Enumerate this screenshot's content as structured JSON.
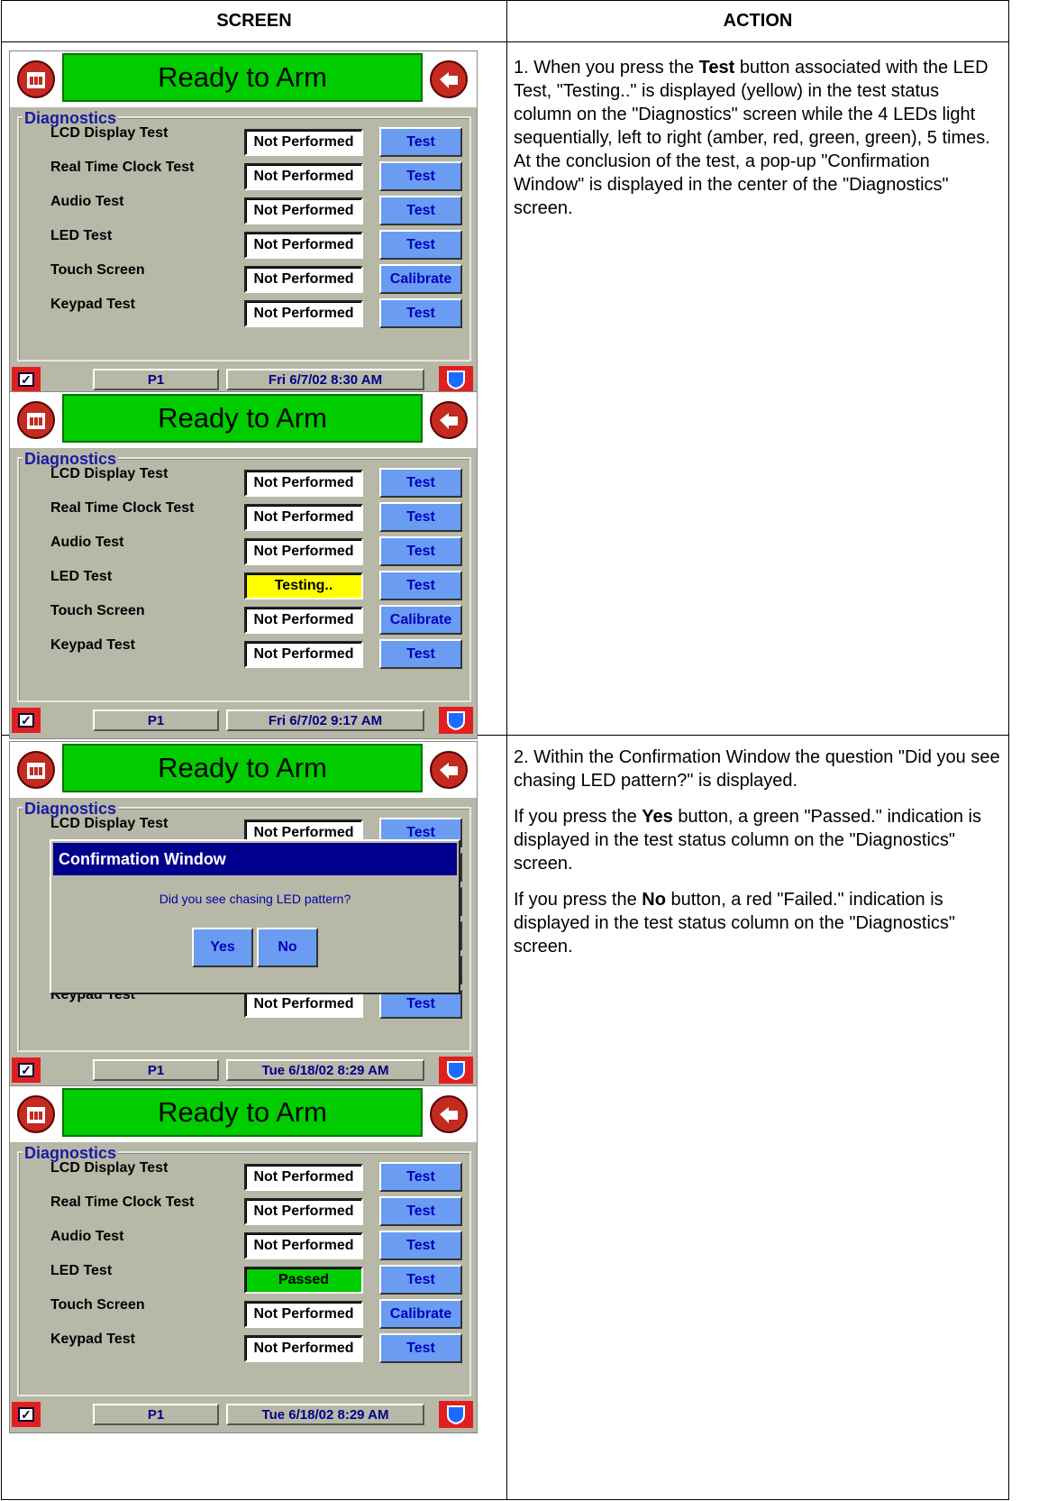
{
  "table": {
    "header_screen": "SCREEN",
    "header_action": "ACTION"
  },
  "device": {
    "banner": "Ready to Arm",
    "group_title": "Diagnostics",
    "page_label": "P1",
    "tests": [
      {
        "label": "LCD Display Test",
        "button": "Test"
      },
      {
        "label": "Real Time Clock Test",
        "button": "Test"
      },
      {
        "label": "Audio Test",
        "button": "Test"
      },
      {
        "label": "LED Test",
        "button": "Test"
      },
      {
        "label": "Touch Screen",
        "button": "Calibrate"
      },
      {
        "label": "Keypad Test",
        "button": "Test"
      }
    ],
    "status_not_performed": "Not Performed",
    "status_testing": "Testing..",
    "status_passed": "Passed",
    "check_glyph": "✓"
  },
  "screens": [
    {
      "datetime": "Fri 6/7/02  8:30 AM"
    },
    {
      "datetime": "Fri 6/7/02  9:17 AM"
    },
    {
      "datetime": "Tue 6/18/02  8:29 AM"
    },
    {
      "datetime": "Tue 6/18/02  8:29 AM"
    }
  ],
  "dialog": {
    "title": "Confirmation Window",
    "question": "Did you see chasing LED pattern?",
    "yes": "Yes",
    "no": "No"
  },
  "actions": {
    "step1": {
      "pre": "1. When you press the ",
      "bold": "Test",
      "post": " button associated with the LED Test, \"Testing..\" is displayed (yellow) in the test status column on the \"Diagnostics\" screen while the 4 LEDs light sequentially, left to right (amber, red, green, green), 5 times.  At the conclusion of the test, a pop-up \"Confirmation Window\" is displayed in the center of the \"Diagnostics\" screen."
    },
    "step2": "2.  Within the Confirmation Window the question \"Did you see chasing LED pattern?\" is displayed.",
    "yes_para": {
      "pre": "If you press the ",
      "bold": "Yes",
      "post": " button, a green \"Passed.\" indication is displayed in the test status column on the \"Diagnostics\" screen."
    },
    "no_para": {
      "pre": "If you press the ",
      "bold": "No",
      "post": " button, a red \"Failed.\" indication is displayed in the test status column on the \"Diagnostics\" screen."
    }
  }
}
